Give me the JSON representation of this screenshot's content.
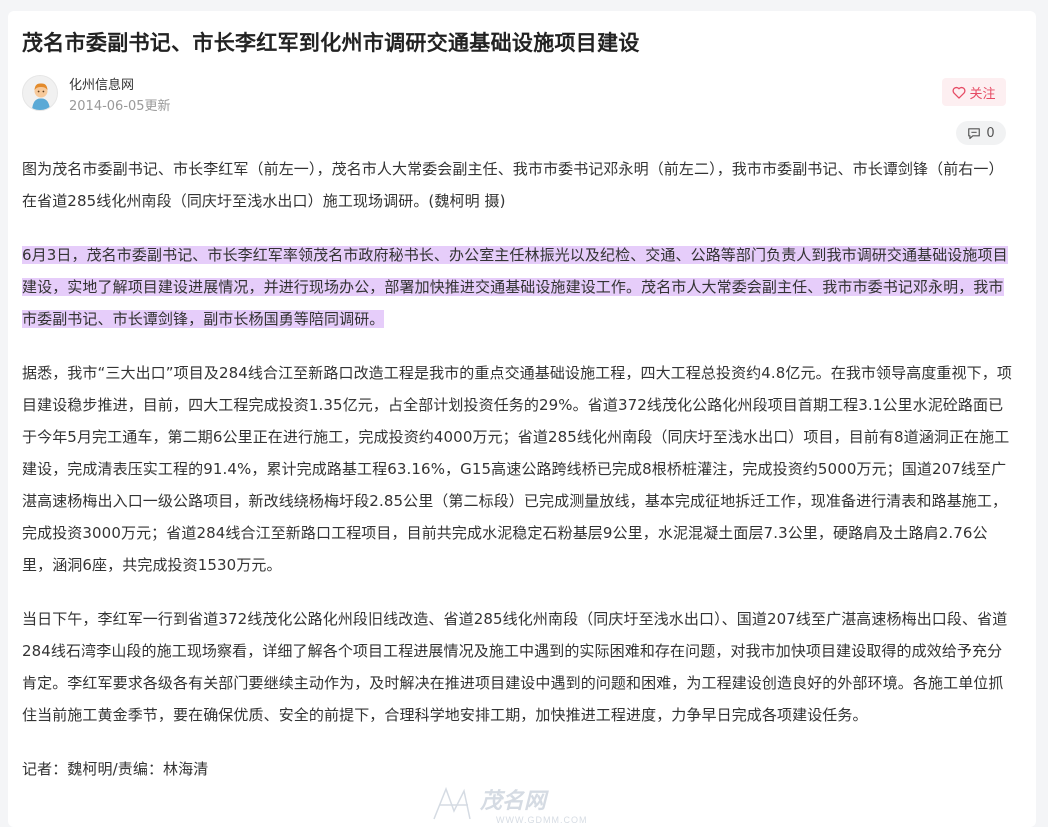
{
  "article": {
    "title": "茂名市委副书记、市长李红军到化州市调研交通基础设施项目建设",
    "author": "化州信息网",
    "updated": "2014-06-05更新",
    "follow_label": "关注",
    "comment_count": "0",
    "caption": "图为茂名市委副书记、市长李红军（前左一），茂名市人大常委会副主任、我市市委书记邓永明（前左二），我市市委副书记、市长谭剑锋（前右一）在省道285线化州南段（同庆圩至浅水出口）施工现场调研。(魏柯明 摄)",
    "paragraphs": [
      " 6月3日，茂名市委副书记、市长李红军率领茂名市政府秘书长、办公室主任林振光以及纪检、交通、公路等部门负责人到我市调研交通基础设施项目建设，实地了解项目建设进展情况，并进行现场办公，部署加快推进交通基础设施建设工作。茂名市人大常委会副主任、我市市委书记邓永明，我市市委副书记、市长谭剑锋，副市长杨国勇等陪同调研。 ",
      "  据悉，我市“三大出口”项目及284线合江至新路口改造工程是我市的重点交通基础设施工程，四大工程总投资约4.8亿元。在我市领导高度重视下，项目建设稳步推进，目前，四大工程完成投资1.35亿元，占全部计划投资任务的29%。省道372线茂化公路化州段项目首期工程3.1公里水泥砼路面已于今年5月完工通车，第二期6公里正在进行施工，完成投资约4000万元；省道285线化州南段（同庆圩至浅水出口）项目，目前有8道涵洞正在施工建设，完成清表压实工程的91.4%，累计完成路基工程63.16%，G15高速公路跨线桥已完成8根桥桩灌注，完成投资约5000万元；国道207线至广湛高速杨梅出入口一级公路项目，新改线绕杨梅圩段2.85公里（第二标段）已完成测量放线，基本完成征地拆迁工作，现准备进行清表和路基施工，完成投资3000万元；省道284线合江至新路口工程项目，目前共完成水泥稳定石粉基层9公里，水泥混凝土面层7.3公里，硬路肩及土路肩2.76公里，涵洞6座，共完成投资1530万元。",
      "  当日下午，李红军一行到省道372线茂化公路化州段旧线改造、省道285线化州南段（同庆圩至浅水出口）、国道207线至广湛高速杨梅出口段、省道284线石湾李山段的施工现场察看，详细了解各个项目工程进展情况及施工中遇到的实际困难和存在问题，对我市加快项目建设取得的成效给予充分肯定。李红军要求各级各有关部门要继续主动作为，及时解决在推进项目建设中遇到的问题和困难，为工程建设创造良好的外部环境。各施工单位抓住当前施工黄金季节，要在确保优质、安全的前提下，合理科学地安排工期，加快推进工程进度，力争早日完成各项建设任务。"
    ],
    "byline": "记者：魏柯明/责编：林海清"
  },
  "watermark": {
    "brand": "茂名网",
    "url": "WWW.GDMM.COM"
  },
  "icons": {
    "heart": "heart-icon",
    "comment": "comment-icon",
    "avatar": "avatar-image"
  },
  "colors": {
    "highlight": "#e6cdfa",
    "follow_text": "#e64b64",
    "follow_bg": "#fdeff1"
  }
}
